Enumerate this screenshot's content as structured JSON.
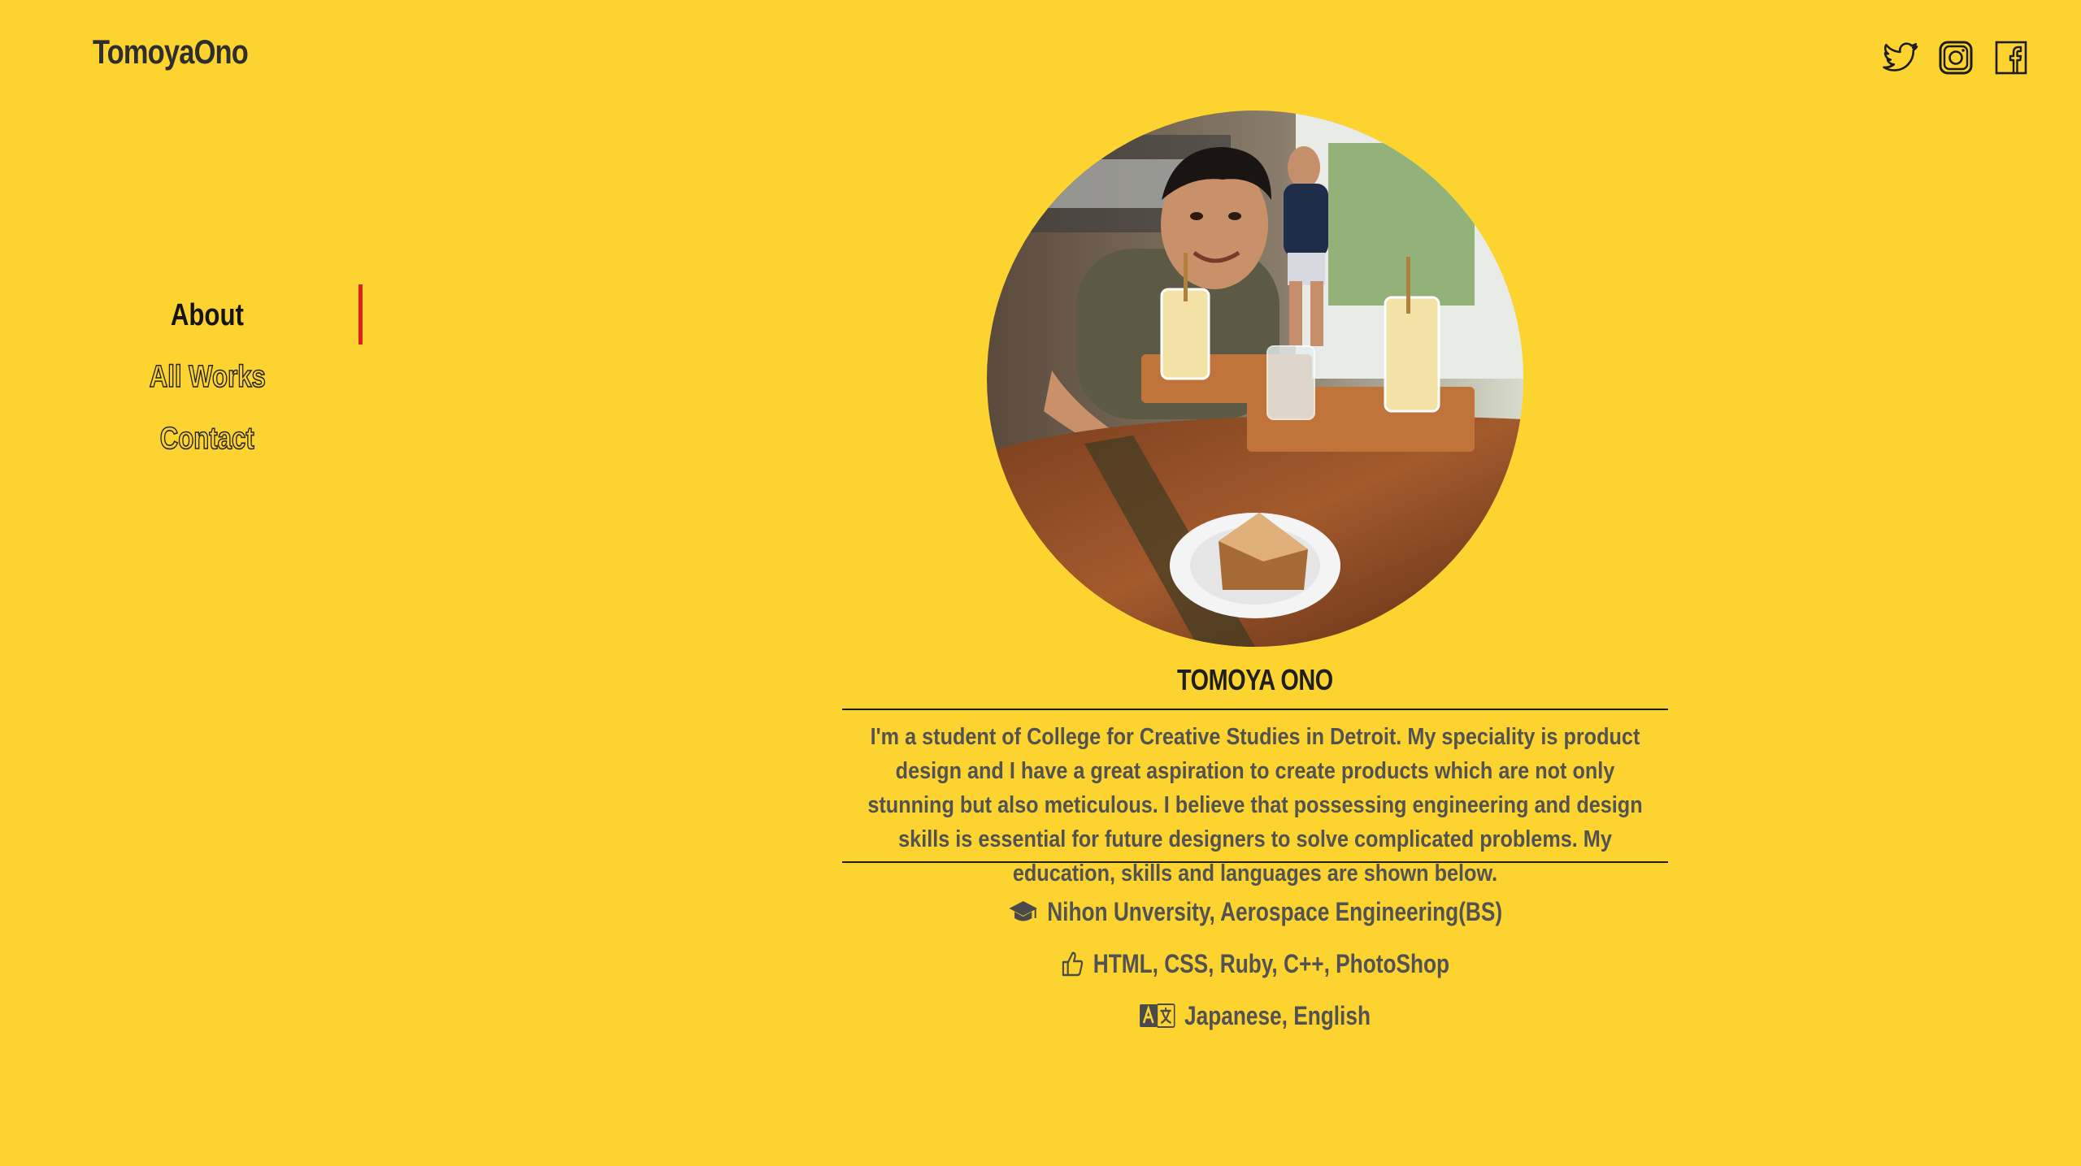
{
  "header": {
    "logo": "TomoyaOno",
    "social": [
      {
        "name": "twitter-icon"
      },
      {
        "name": "instagram-icon"
      },
      {
        "name": "facebook-icon"
      }
    ]
  },
  "nav": {
    "items": [
      {
        "label": "About",
        "active": true
      },
      {
        "label": "All Works",
        "active": false
      },
      {
        "label": "Contact",
        "active": false
      }
    ],
    "indicator_color": "#e0201c"
  },
  "profile": {
    "name": "TOMOYA ONO",
    "bio": "I'm a student of College for Creative Studies in Detroit. My speciality is product design and I have a great aspiration to create products which are not only stunning but also meticulous. I believe that possessing engineering and design skills is essential for future designers to solve complicated problems. My education, skills and languages are shown below.",
    "education": {
      "icon": "graduation-cap-icon",
      "text": "Nihon Unversity, Aerospace Engineering(BS)"
    },
    "skills": {
      "icon": "thumbs-up-icon",
      "text": "HTML, CSS, Ruby, C++, PhotoShop"
    },
    "languages": {
      "icon": "language-icon",
      "text": "Japanese, English"
    }
  },
  "colors": {
    "background": "#fdd42f",
    "text": "#2b2b2b",
    "accent": "#e0201c"
  }
}
